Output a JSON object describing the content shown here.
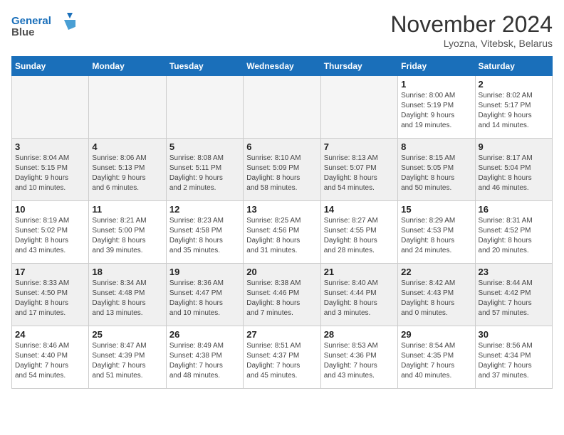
{
  "logo": {
    "line1": "General",
    "line2": "Blue"
  },
  "title": "November 2024",
  "subtitle": "Lyozna, Vitebsk, Belarus",
  "days_of_week": [
    "Sunday",
    "Monday",
    "Tuesday",
    "Wednesday",
    "Thursday",
    "Friday",
    "Saturday"
  ],
  "weeks": [
    [
      {
        "day": "",
        "info": ""
      },
      {
        "day": "",
        "info": ""
      },
      {
        "day": "",
        "info": ""
      },
      {
        "day": "",
        "info": ""
      },
      {
        "day": "",
        "info": ""
      },
      {
        "day": "1",
        "info": "Sunrise: 8:00 AM\nSunset: 5:19 PM\nDaylight: 9 hours\nand 19 minutes."
      },
      {
        "day": "2",
        "info": "Sunrise: 8:02 AM\nSunset: 5:17 PM\nDaylight: 9 hours\nand 14 minutes."
      }
    ],
    [
      {
        "day": "3",
        "info": "Sunrise: 8:04 AM\nSunset: 5:15 PM\nDaylight: 9 hours\nand 10 minutes."
      },
      {
        "day": "4",
        "info": "Sunrise: 8:06 AM\nSunset: 5:13 PM\nDaylight: 9 hours\nand 6 minutes."
      },
      {
        "day": "5",
        "info": "Sunrise: 8:08 AM\nSunset: 5:11 PM\nDaylight: 9 hours\nand 2 minutes."
      },
      {
        "day": "6",
        "info": "Sunrise: 8:10 AM\nSunset: 5:09 PM\nDaylight: 8 hours\nand 58 minutes."
      },
      {
        "day": "7",
        "info": "Sunrise: 8:13 AM\nSunset: 5:07 PM\nDaylight: 8 hours\nand 54 minutes."
      },
      {
        "day": "8",
        "info": "Sunrise: 8:15 AM\nSunset: 5:05 PM\nDaylight: 8 hours\nand 50 minutes."
      },
      {
        "day": "9",
        "info": "Sunrise: 8:17 AM\nSunset: 5:04 PM\nDaylight: 8 hours\nand 46 minutes."
      }
    ],
    [
      {
        "day": "10",
        "info": "Sunrise: 8:19 AM\nSunset: 5:02 PM\nDaylight: 8 hours\nand 43 minutes."
      },
      {
        "day": "11",
        "info": "Sunrise: 8:21 AM\nSunset: 5:00 PM\nDaylight: 8 hours\nand 39 minutes."
      },
      {
        "day": "12",
        "info": "Sunrise: 8:23 AM\nSunset: 4:58 PM\nDaylight: 8 hours\nand 35 minutes."
      },
      {
        "day": "13",
        "info": "Sunrise: 8:25 AM\nSunset: 4:56 PM\nDaylight: 8 hours\nand 31 minutes."
      },
      {
        "day": "14",
        "info": "Sunrise: 8:27 AM\nSunset: 4:55 PM\nDaylight: 8 hours\nand 28 minutes."
      },
      {
        "day": "15",
        "info": "Sunrise: 8:29 AM\nSunset: 4:53 PM\nDaylight: 8 hours\nand 24 minutes."
      },
      {
        "day": "16",
        "info": "Sunrise: 8:31 AM\nSunset: 4:52 PM\nDaylight: 8 hours\nand 20 minutes."
      }
    ],
    [
      {
        "day": "17",
        "info": "Sunrise: 8:33 AM\nSunset: 4:50 PM\nDaylight: 8 hours\nand 17 minutes."
      },
      {
        "day": "18",
        "info": "Sunrise: 8:34 AM\nSunset: 4:48 PM\nDaylight: 8 hours\nand 13 minutes."
      },
      {
        "day": "19",
        "info": "Sunrise: 8:36 AM\nSunset: 4:47 PM\nDaylight: 8 hours\nand 10 minutes."
      },
      {
        "day": "20",
        "info": "Sunrise: 8:38 AM\nSunset: 4:46 PM\nDaylight: 8 hours\nand 7 minutes."
      },
      {
        "day": "21",
        "info": "Sunrise: 8:40 AM\nSunset: 4:44 PM\nDaylight: 8 hours\nand 3 minutes."
      },
      {
        "day": "22",
        "info": "Sunrise: 8:42 AM\nSunset: 4:43 PM\nDaylight: 8 hours\nand 0 minutes."
      },
      {
        "day": "23",
        "info": "Sunrise: 8:44 AM\nSunset: 4:42 PM\nDaylight: 7 hours\nand 57 minutes."
      }
    ],
    [
      {
        "day": "24",
        "info": "Sunrise: 8:46 AM\nSunset: 4:40 PM\nDaylight: 7 hours\nand 54 minutes."
      },
      {
        "day": "25",
        "info": "Sunrise: 8:47 AM\nSunset: 4:39 PM\nDaylight: 7 hours\nand 51 minutes."
      },
      {
        "day": "26",
        "info": "Sunrise: 8:49 AM\nSunset: 4:38 PM\nDaylight: 7 hours\nand 48 minutes."
      },
      {
        "day": "27",
        "info": "Sunrise: 8:51 AM\nSunset: 4:37 PM\nDaylight: 7 hours\nand 45 minutes."
      },
      {
        "day": "28",
        "info": "Sunrise: 8:53 AM\nSunset: 4:36 PM\nDaylight: 7 hours\nand 43 minutes."
      },
      {
        "day": "29",
        "info": "Sunrise: 8:54 AM\nSunset: 4:35 PM\nDaylight: 7 hours\nand 40 minutes."
      },
      {
        "day": "30",
        "info": "Sunrise: 8:56 AM\nSunset: 4:34 PM\nDaylight: 7 hours\nand 37 minutes."
      }
    ]
  ]
}
